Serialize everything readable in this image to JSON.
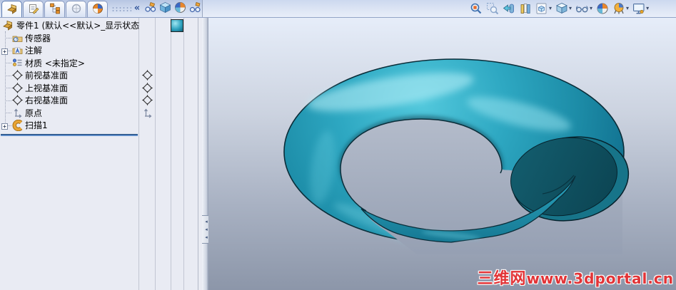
{
  "chrome": {
    "collapse_glyph": "«",
    "dropdown_caret": "▾",
    "splitter_arrow": "◂"
  },
  "panel_tabs": [
    {
      "icon": "feature-tree-tab-icon"
    },
    {
      "icon": "property-manager-tab-icon"
    },
    {
      "icon": "configuration-manager-tab-icon"
    },
    {
      "icon": "dimxpert-tab-icon"
    },
    {
      "icon": "display-manager-tab-icon"
    }
  ],
  "panel_header_icons": [
    {
      "icon": "filter-tree-icon"
    },
    {
      "icon": "display-pane-cube-icon"
    },
    {
      "icon": "appearance-ball-icon"
    },
    {
      "icon": "filter-glasses-icon"
    }
  ],
  "feature_tree": {
    "root_label": "零件1  (默认<<默认>_显示状态",
    "items": [
      {
        "label": "传感器",
        "icon": "sensors-folder-icon",
        "expandable": false
      },
      {
        "label": "注解",
        "icon": "annotations-folder-icon",
        "expandable": true
      },
      {
        "label": "材质 <未指定>",
        "icon": "material-icon",
        "expandable": false
      },
      {
        "label": "前视基准面",
        "icon": "plane-icon",
        "display_pane_icon": "plane-icon"
      },
      {
        "label": "上视基准面",
        "icon": "plane-icon",
        "display_pane_icon": "plane-icon"
      },
      {
        "label": "右视基准面",
        "icon": "plane-icon",
        "display_pane_icon": "plane-icon"
      },
      {
        "label": "原点",
        "icon": "origin-icon",
        "display_pane_icon": "origin-icon"
      },
      {
        "label": "扫描1",
        "icon": "sweep-icon",
        "expandable": true
      }
    ],
    "display_pane_header_icon": "appearance-sphere-icon"
  },
  "headsup_toolbar": {
    "buttons": [
      {
        "name": "zoom-to-fit",
        "has_dropdown": false
      },
      {
        "name": "zoom-to-area",
        "has_dropdown": false
      },
      {
        "name": "previous-view",
        "has_dropdown": false
      },
      {
        "name": "section-view",
        "has_dropdown": false
      },
      {
        "name": "view-orientation",
        "has_dropdown": true
      },
      {
        "name": "display-style",
        "has_dropdown": true
      },
      {
        "name": "hide-show-items",
        "has_dropdown": true
      },
      {
        "name": "edit-appearance",
        "has_dropdown": false
      },
      {
        "name": "apply-scene",
        "has_dropdown": true
      },
      {
        "name": "view-settings",
        "has_dropdown": true
      }
    ]
  },
  "viewport": {
    "watermark_brand": "三维网",
    "watermark_url": "www.3dportal.cn",
    "model_name": "扫描1 spiral sweep solid"
  },
  "colors": {
    "model_teal": "#1f93ae",
    "model_cap": "#0d4654",
    "watermark_red": "#e23437",
    "accent_blue": "#3f6fae",
    "panel_bg": "#e9ebf3",
    "viewport_top": "#e6edf9",
    "viewport_bottom": "#8c96a9"
  }
}
